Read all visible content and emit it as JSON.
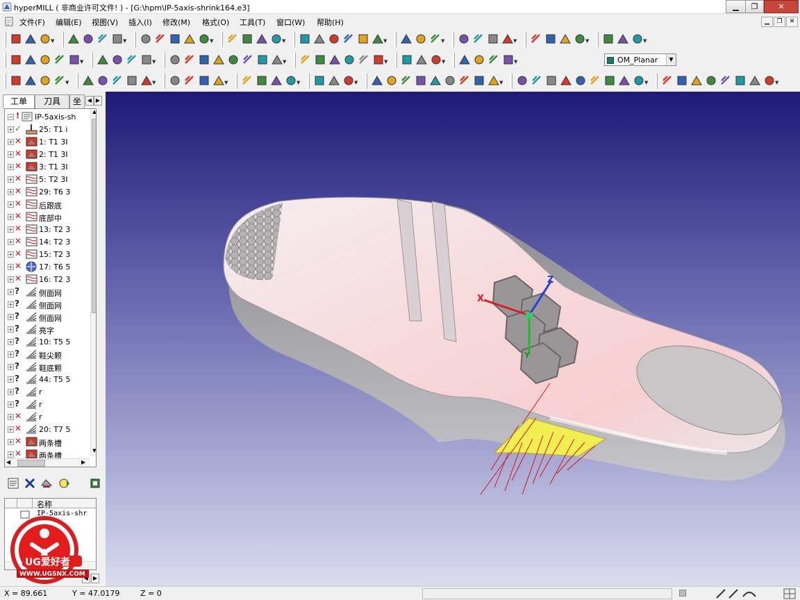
{
  "window": {
    "app_name": "hyperMILL",
    "subtitle": "( 非商业许可文件! ) - [G:\\hpm\\IP-5axis-shrink164.e3]",
    "min_label": "▁",
    "max_label": "❐",
    "close_label": "✕"
  },
  "menu": {
    "items": [
      "文件(F)",
      "编辑(E)",
      "视图(V)",
      "插入(I)",
      "修改(M)",
      "格式(O)",
      "工具(T)",
      "窗口(W)",
      "帮助(H)"
    ]
  },
  "toolbar": {
    "layer_name": "OM_Planar",
    "layer_color": "#177a6e"
  },
  "left_panel": {
    "tabs": [
      "工单",
      "刀具",
      "坐"
    ],
    "tree_root": "IP-5axis-sh",
    "tree_items": [
      {
        "status": "ok",
        "icon": "drill",
        "label": "25: T1 i"
      },
      {
        "status": "off",
        "icon": "mill",
        "label": "1: T1 3I"
      },
      {
        "status": "off",
        "icon": "mill",
        "label": "2: T1 3I"
      },
      {
        "status": "off",
        "icon": "mill",
        "label": "3: T1 3I"
      },
      {
        "status": "off",
        "icon": "flow",
        "label": "5: T2 3I"
      },
      {
        "status": "off",
        "icon": "flow",
        "label": "29: T6 3"
      },
      {
        "status": "off",
        "icon": "flow",
        "label": "后跟底"
      },
      {
        "status": "off",
        "icon": "flow",
        "label": "底部中"
      },
      {
        "status": "off",
        "icon": "flow",
        "label": "13: T2 3"
      },
      {
        "status": "off",
        "icon": "flow",
        "label": "14: T2 3"
      },
      {
        "status": "off",
        "icon": "flow",
        "label": "15: T2 3"
      },
      {
        "status": "off",
        "icon": "globe",
        "label": "17: T6 5"
      },
      {
        "status": "off",
        "icon": "flow",
        "label": "16: T2 3"
      },
      {
        "status": "q",
        "icon": "fan",
        "label": "侧面网"
      },
      {
        "status": "q",
        "icon": "fan",
        "label": "侧面网"
      },
      {
        "status": "q",
        "icon": "fan",
        "label": "侧面网"
      },
      {
        "status": "q",
        "icon": "fan",
        "label": "亮字"
      },
      {
        "status": "q",
        "icon": "fan",
        "label": "10: T5 5"
      },
      {
        "status": "q",
        "icon": "fan",
        "label": "鞋尖颗"
      },
      {
        "status": "q",
        "icon": "fan",
        "label": "鞋底颗"
      },
      {
        "status": "q",
        "icon": "fan",
        "label": "44: T5 5"
      },
      {
        "status": "q",
        "icon": "fan",
        "label": "r"
      },
      {
        "status": "q",
        "icon": "fan",
        "label": "r"
      },
      {
        "status": "off",
        "icon": "fan",
        "label": "r"
      },
      {
        "status": "off",
        "icon": "fan",
        "label": "20: T7 5"
      },
      {
        "status": "off",
        "icon": "mill",
        "label": "两条槽"
      },
      {
        "status": "off",
        "icon": "mill",
        "label": "两条槽"
      }
    ],
    "props_header": "名称",
    "props_value": "IP-5axis-shr"
  },
  "watermark": {
    "brand": "UG爱好者",
    "url": "WWW.UGSNX.COM"
  },
  "axes": {
    "x": "X",
    "y": "Y",
    "z": "Z"
  },
  "status": {
    "x": "X = 89.661",
    "y": "Y = 47.0179",
    "z": "Z = 0"
  }
}
